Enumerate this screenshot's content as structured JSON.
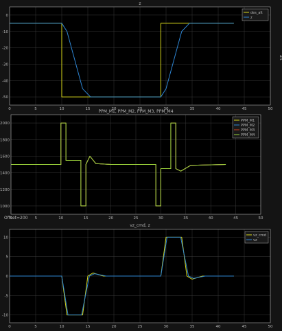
{
  "colors": {
    "background": "#141414",
    "axes_bg": "#000000",
    "grid": "#3a3a3a",
    "frame": "#b0b0b0",
    "text": "#b8b8b8",
    "yellow": "#d8d81a",
    "blue": "#2e86d4",
    "red": "#d0401e",
    "green": "#9ad13a"
  },
  "offset_label": "Offset=200",
  "side_label": "alt",
  "chart_data": [
    {
      "type": "line",
      "title": "z",
      "xlabel": "",
      "ylabel": "",
      "xlim": [
        0,
        50
      ],
      "ylim": [
        -55,
        5
      ],
      "grid": true,
      "legend": "top-right",
      "xticks": [
        "0",
        "5",
        "10",
        "15",
        "20",
        "25",
        "30",
        "35",
        "40",
        "45",
        "50"
      ],
      "yticks": [
        "0",
        "-10",
        "-20",
        "-30",
        "-40",
        "-50"
      ],
      "series": [
        {
          "name": "des_alt",
          "color": "yellow",
          "x": [
            0,
            10,
            10,
            29,
            29,
            43
          ],
          "y": [
            -5,
            -5,
            -50,
            -50,
            -5,
            -5
          ]
        },
        {
          "name": "z",
          "color": "blue",
          "x": [
            0,
            10,
            11,
            14,
            15.5,
            29,
            30,
            33,
            34.5,
            43
          ],
          "y": [
            -5,
            -5,
            -10,
            -45,
            -50,
            -50,
            -45,
            -10,
            -5,
            -5
          ]
        }
      ]
    },
    {
      "type": "line",
      "title": "PPM_M1, PPM_M2, PPM_M3, PPM_M4",
      "xlabel": "",
      "ylabel": "",
      "xlim": [
        0,
        50
      ],
      "ylim": [
        900,
        2100
      ],
      "grid": true,
      "legend": "top-right",
      "xticks": [
        "0",
        "5",
        "10",
        "15",
        "20",
        "25",
        "30",
        "35",
        "40",
        "45",
        "50"
      ],
      "yticks": [
        "2000",
        "1800",
        "1600",
        "1400",
        "1200",
        "1000"
      ],
      "series": [
        {
          "name": "PPM_M1",
          "color": "yellow",
          "x": [
            0,
            10,
            10,
            11,
            11,
            14,
            14,
            15,
            15,
            15.8,
            17,
            20,
            29,
            29,
            30,
            30,
            32,
            32,
            33,
            33,
            34,
            36,
            43
          ],
          "y": [
            1500,
            1500,
            2000,
            2000,
            1550,
            1550,
            1000,
            1000,
            1500,
            1600,
            1510,
            1500,
            1500,
            1000,
            1000,
            1450,
            1450,
            2000,
            2000,
            1450,
            1420,
            1490,
            1500
          ]
        },
        {
          "name": "PPM_M2",
          "color": "blue",
          "x": [
            0,
            10,
            10,
            11,
            11,
            14,
            14,
            15,
            15,
            15.8,
            17,
            20,
            29,
            29,
            30,
            30,
            32,
            32,
            33,
            33,
            34,
            36,
            43
          ],
          "y": [
            1500,
            1500,
            2000,
            2000,
            1550,
            1550,
            1000,
            1000,
            1500,
            1600,
            1510,
            1500,
            1500,
            1000,
            1000,
            1450,
            1450,
            2000,
            2000,
            1450,
            1420,
            1490,
            1500
          ]
        },
        {
          "name": "PPM_M3",
          "color": "red",
          "x": [
            0,
            10,
            10,
            11,
            11,
            14,
            14,
            15,
            15,
            15.8,
            17,
            20,
            29,
            29,
            30,
            30,
            32,
            32,
            33,
            33,
            34,
            36,
            43
          ],
          "y": [
            1500,
            1500,
            2000,
            2000,
            1550,
            1550,
            1000,
            1000,
            1500,
            1600,
            1510,
            1500,
            1500,
            1000,
            1000,
            1450,
            1450,
            2000,
            2000,
            1450,
            1420,
            1490,
            1500
          ]
        },
        {
          "name": "PPM_M4",
          "color": "green",
          "x": [
            0,
            10,
            10,
            11,
            11,
            14,
            14,
            15,
            15,
            15.8,
            17,
            20,
            29,
            29,
            30,
            30,
            32,
            32,
            33,
            33,
            34,
            36,
            43
          ],
          "y": [
            1500,
            1500,
            2000,
            2000,
            1550,
            1550,
            1000,
            1000,
            1500,
            1600,
            1510,
            1500,
            1500,
            1000,
            1000,
            1450,
            1450,
            2000,
            2000,
            1450,
            1420,
            1490,
            1500
          ]
        }
      ]
    },
    {
      "type": "line",
      "title": "vz_cmd, z",
      "xlabel": "",
      "ylabel": "",
      "xlim": [
        0,
        50
      ],
      "ylim": [
        -12,
        12
      ],
      "grid": true,
      "legend": "top-right",
      "xticks": [
        "0",
        "5",
        "10",
        "15",
        "20",
        "25",
        "30",
        "35",
        "40",
        "45",
        "50"
      ],
      "yticks": [
        "10",
        "5",
        "0",
        "-5",
        "-10"
      ],
      "series": [
        {
          "name": "vz_cmd",
          "color": "yellow",
          "x": [
            0,
            10,
            11,
            14,
            15,
            16,
            18,
            29,
            30,
            33,
            34,
            35,
            37,
            43
          ],
          "y": [
            0,
            0,
            -10,
            -10,
            0,
            0.8,
            0,
            0,
            10,
            10,
            0,
            -0.8,
            0,
            0
          ]
        },
        {
          "name": "vz",
          "color": "blue",
          "x": [
            0,
            10,
            11.2,
            13.8,
            15.3,
            16.3,
            18.5,
            29,
            30.2,
            32.8,
            34.3,
            35.3,
            37.5,
            43
          ],
          "y": [
            0,
            0,
            -10,
            -10,
            0,
            0.6,
            0,
            0,
            10,
            10,
            0,
            -0.6,
            0,
            0
          ]
        }
      ]
    }
  ]
}
